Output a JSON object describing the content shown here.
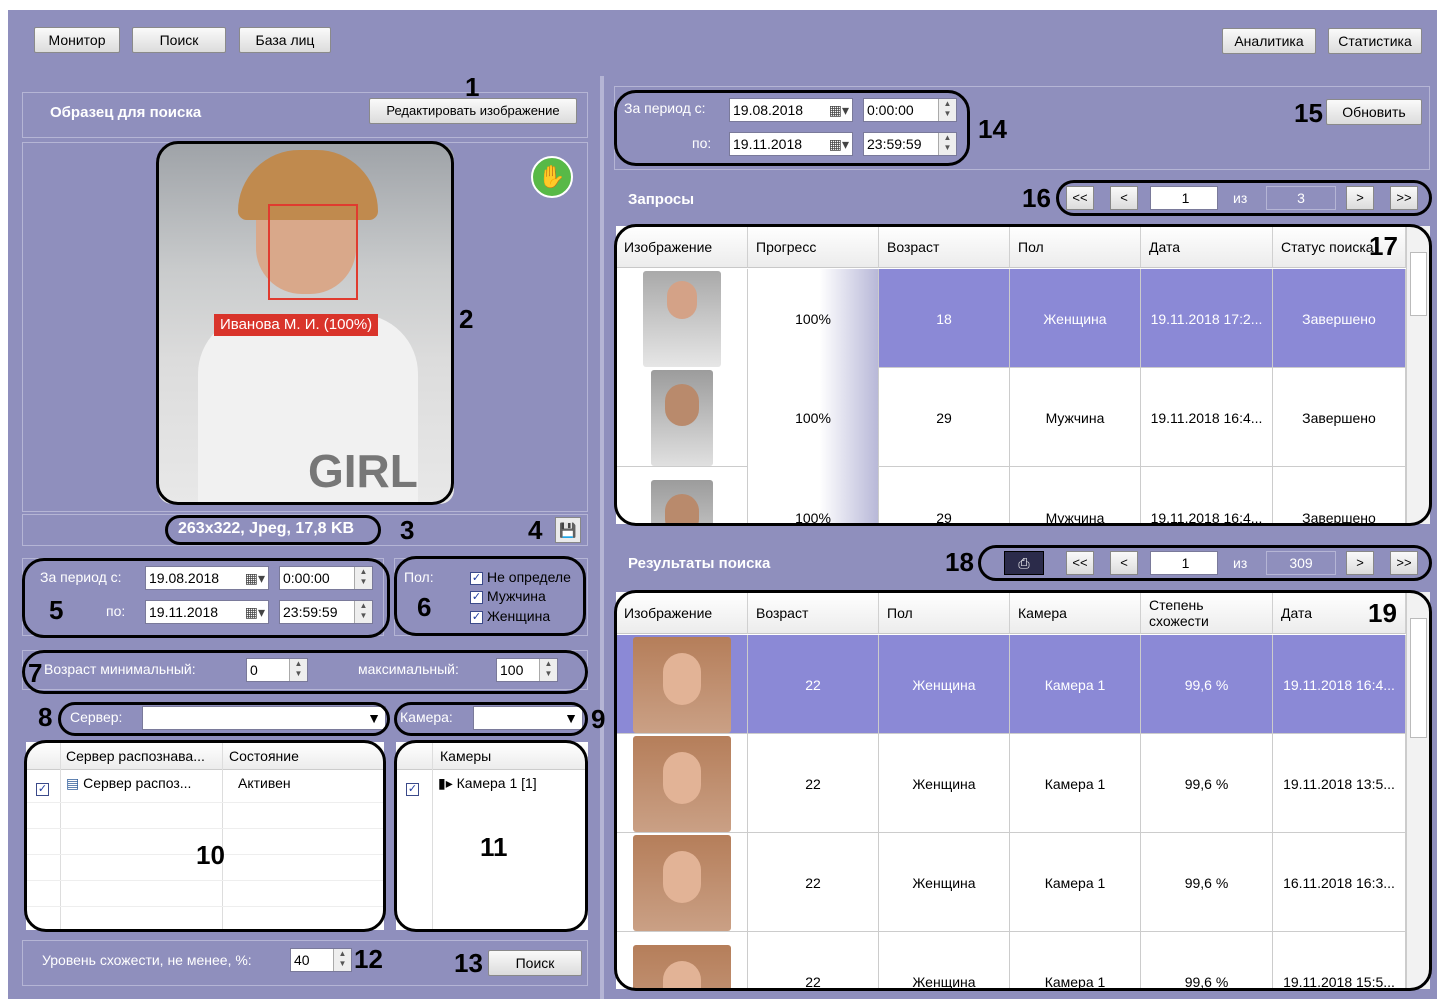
{
  "toolbar": {
    "monitor": "Монитор",
    "search": "Поиск",
    "face_db": "База лиц",
    "analytics": "Аналитика",
    "statistics": "Статистика"
  },
  "sample": {
    "title": "Образец для поиска",
    "edit_button": "Редактировать изображение",
    "face_label": "Иванова М. И. (100%)",
    "image_info": "263x322, Jpeg, 17,8 KB"
  },
  "period_left": {
    "from_label": "За период с:",
    "to_label": "по:",
    "from_date": "19.08.2018",
    "from_time": "0:00:00",
    "to_date": "19.11.2018",
    "to_time": "23:59:59"
  },
  "gender": {
    "label": "Пол:",
    "options": [
      "Не определе",
      "Мужчина",
      "Женщина"
    ]
  },
  "age": {
    "min_label": "Возраст минимальный:",
    "min_value": "0",
    "max_label": "максимальный:",
    "max_value": "100"
  },
  "server_label": "Сервер:",
  "camera_label": "Камера:",
  "servers_table": {
    "col_server": "Сервер распознава...",
    "col_state": "Состояние",
    "row_server": "Сервер распоз...",
    "row_state": "Активен"
  },
  "cameras_table": {
    "col": "Камеры",
    "row": "Камера 1 [1]"
  },
  "similarity": {
    "label": "Уровень схожести, не менее, %:",
    "value": "40",
    "search_button": "Поиск"
  },
  "period_right": {
    "from_label": "За период с:",
    "to_label": "по:",
    "from_date": "19.08.2018",
    "from_time": "0:00:00",
    "to_date": "19.11.2018",
    "to_time": "23:59:59",
    "refresh": "Обновить"
  },
  "requests": {
    "title": "Запросы",
    "page": "1",
    "of": "из",
    "total": "3",
    "headers": [
      "Изображение",
      "Прогресс",
      "Возраст",
      "Пол",
      "Дата",
      "Статус поиска"
    ],
    "rows": [
      {
        "progress": "100%",
        "age": "18",
        "gender": "Женщина",
        "date": "19.11.2018 17:2...",
        "status": "Завершено"
      },
      {
        "progress": "100%",
        "age": "29",
        "gender": "Мужчина",
        "date": "19.11.2018 16:4...",
        "status": "Завершено"
      },
      {
        "progress": "100%",
        "age": "29",
        "gender": "Мужчина",
        "date": "19.11.2018 16:4...",
        "status": "Завершено"
      }
    ]
  },
  "results": {
    "title": "Результаты поиска",
    "page": "1",
    "of": "из",
    "total": "309",
    "headers": [
      "Изображение",
      "Возраст",
      "Пол",
      "Камера",
      "Степень схожести",
      "Дата"
    ],
    "rows": [
      {
        "age": "22",
        "gender": "Женщина",
        "camera": "Камера 1",
        "similarity": "99,6 %",
        "date": "19.11.2018 16:4..."
      },
      {
        "age": "22",
        "gender": "Женщина",
        "camera": "Камера 1",
        "similarity": "99,6 %",
        "date": "19.11.2018 13:5..."
      },
      {
        "age": "22",
        "gender": "Женщина",
        "camera": "Камера 1",
        "similarity": "99,6 %",
        "date": "16.11.2018 16:3..."
      },
      {
        "age": "22",
        "gender": "Женщина",
        "camera": "Камера 1",
        "similarity": "99,6 %",
        "date": "19.11.2018 15:5..."
      }
    ]
  },
  "callouts": [
    "1",
    "2",
    "3",
    "4",
    "5",
    "6",
    "7",
    "8",
    "9",
    "10",
    "11",
    "12",
    "13",
    "14",
    "15",
    "16",
    "17",
    "18",
    "19"
  ],
  "colors": {
    "background": "#8f8fbd",
    "selected_row": "#8b89d6",
    "face_label": "#d9342b",
    "ok_badge": "#58b947"
  }
}
